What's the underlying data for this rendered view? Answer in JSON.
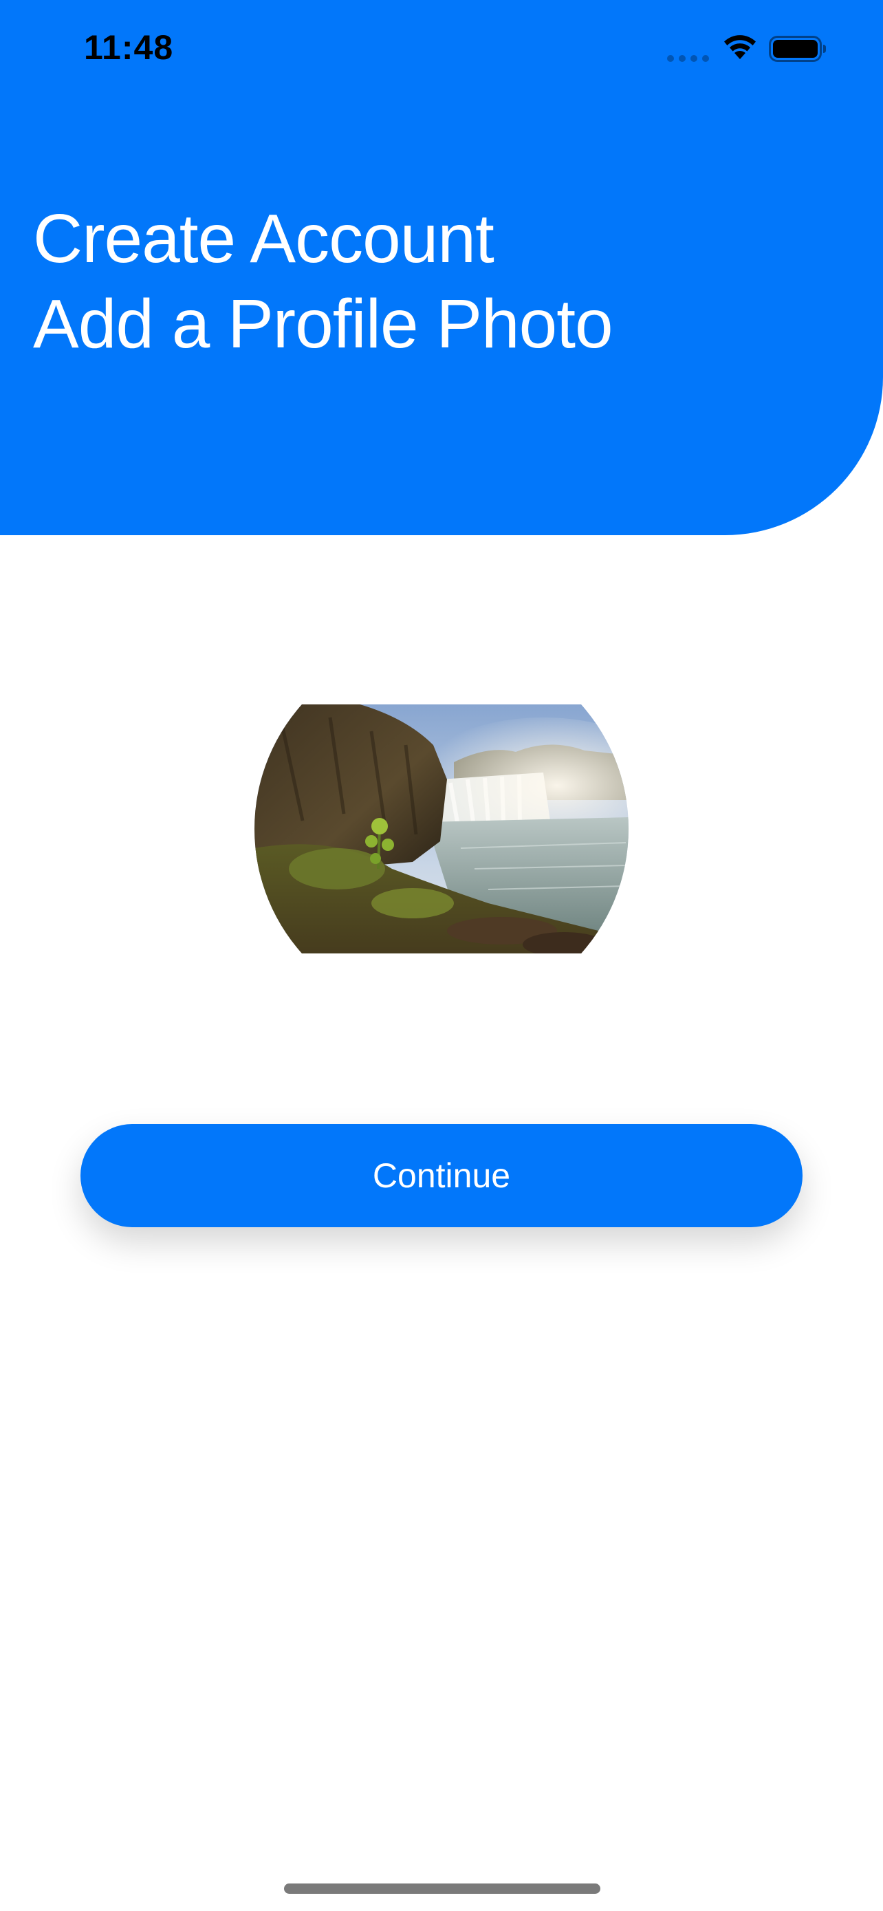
{
  "status_bar": {
    "time": "11:48",
    "icons": [
      "cellular-signal-icon",
      "wifi-icon",
      "battery-icon"
    ]
  },
  "header": {
    "title_line1": "Create Account",
    "title_line2": "Add a Profile Photo",
    "background_color": "#0277FA",
    "text_color": "#FFFFFF"
  },
  "profile_photo": {
    "subject": "waterfall landscape photo"
  },
  "continue_button": {
    "label": "Continue",
    "background_color": "#0277FA",
    "text_color": "#FFFFFF"
  }
}
